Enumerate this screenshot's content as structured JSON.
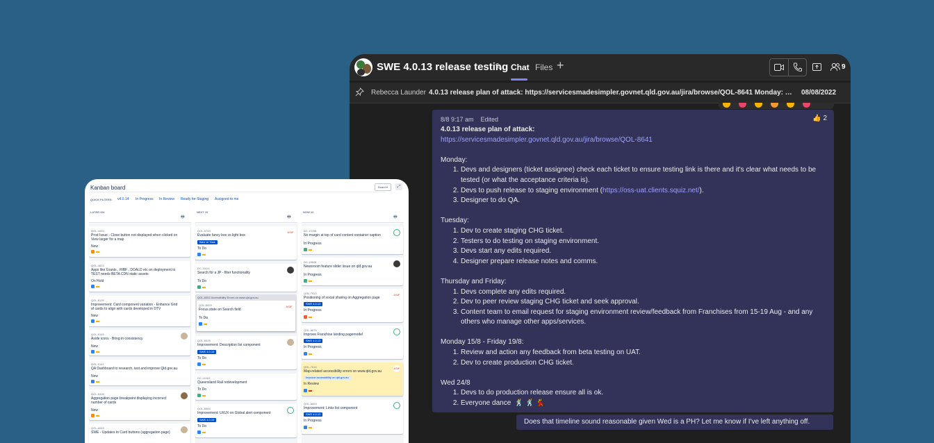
{
  "teams": {
    "title": "SWE 4.0.13 release testing",
    "tabs": {
      "chat": "Chat",
      "files": "Files"
    },
    "participants_count": "9",
    "pinned": {
      "author": "Rebecca Launder",
      "text": "4.0.13 release plan of attack: https://servicesmadesimpler.govnet.qld.gov.au/jira/browse/QOL-8641 Monday: Devs and designers (ticket assignee) check each ticket",
      "date": "08/08/2022"
    },
    "message": {
      "time": "8/8 9:17 am",
      "edited": "Edited",
      "reaction_count": "2",
      "heading": "4.0.13 release plan of attack:",
      "link": "https://servicesmadesimpler.govnet.qld.gov.au/jira/browse/QOL-8641",
      "monday": {
        "label": "Monday:",
        "items": [
          "Devs and designers (ticket assignee) check each ticket to ensure testing link is there and it's clear what needs to be tested (or what the acceptance criteria is).",
          "Devs to push release to staging environment (",
          "Designer to do QA."
        ],
        "staging_link": "https://oss-uat.clients.squiz.net/",
        "staging_suffix": ")."
      },
      "tuesday": {
        "label": "Tuesday:",
        "items": [
          "Dev to create staging CHG ticket.",
          "Testers to do testing on staging environment.",
          "Devs start any edits required.",
          "Designer prepare release notes and comms."
        ]
      },
      "thu_fri": {
        "label": "Thursday and Friday:",
        "items": [
          "Devs complete any edits required.",
          "Dev to peer review staging CHG ticket and seek approval.",
          "Content team to email request for staging environment review/feedback from Franchises from 15-19 Aug - and any others who manage other apps/services."
        ]
      },
      "mon_fri": {
        "label": "Monday 15/8 - Friday 19/8:",
        "items": [
          "Review and action any feedback from beta testing on UAT.",
          "Dev to create production CHG ticket."
        ]
      },
      "wed": {
        "label": "Wed 24/8",
        "items": [
          "Devs to do production release ensure all is ok.",
          "Everyone dance"
        ],
        "dance_emoji": "🕺 🕺 💃"
      }
    },
    "reply": "Does that timeline sound reasonable given Wed is a PH? Let me know if I've left anything off."
  },
  "jira": {
    "title": "Kanban board",
    "board_select": "Board",
    "quick_filters_label": "QUICK FILTERS:",
    "quick_filters": [
      "v4.0.14",
      "In Progress",
      "In Review",
      "Ready for Staging",
      "Assigned to me"
    ],
    "columns": [
      "LATER ON",
      "NEXT 20",
      "NOW 10"
    ],
    "later": [
      {
        "key": "QOL-4493",
        "summary": "Prod Issue - Close button not displayed when clicked on View larger for a map",
        "status": "New"
      },
      {
        "key": "QOL-4823",
        "summary": "Apps like Grants , HIBF , DOALD etc on deployment to TEST needs BETA CDN static assets",
        "status": "On Hold"
      },
      {
        "key": "QOL-8139",
        "summary": "Improvement: Card component variation - Enhance Grid of cards to align with cards developed in DTV",
        "status": "New"
      },
      {
        "key": "QOL-5145",
        "summary": "Aside icons - Bring in consistency",
        "status": "New"
      },
      {
        "key": "QOL-5141",
        "summary": "QA Dashboard to research, test and improve Qld.gov.au",
        "status": "New"
      },
      {
        "key": "QOL-5406",
        "summary": "Aggregation page breakpoint displaying incorrect number of cards",
        "status": "New"
      },
      {
        "key": "QOL-6943",
        "summary": "SWE - Updates to Card buttons (aggregation page)",
        "status": ""
      }
    ],
    "next": [
      {
        "key": "QOL-5749",
        "summary": "Evaluate fancy box vs light box",
        "chip": "BAU UI Task",
        "status": "To Do"
      },
      {
        "key": "DC-11641",
        "summary": "Search for a JP - filter functionality",
        "chip": "",
        "status": "To Do"
      },
      {
        "key": "QOL-6009",
        "summary": "Focus state on Search field",
        "chip": "",
        "status": "To Do"
      },
      {
        "key": "QOL-8028",
        "summary": "Improvement: Description list component",
        "chip": "SWE 4.0.15",
        "status": "To Do"
      },
      {
        "key": "DC-14463",
        "summary": "Queensland Rail redevelopment",
        "chip": "",
        "status": "To Do"
      },
      {
        "key": "QOL-8584",
        "summary": "Improvement: UI/UX on Global alert component",
        "chip": "SWE 4.0.15",
        "status": "To Do"
      }
    ],
    "next_group": "QOL-6002  Accessibility Errors on www.qld.gov.au",
    "now": [
      {
        "key": "DC-13786",
        "summary": "No margin at top of card content container caption",
        "chip": "",
        "status": "In Progress"
      },
      {
        "key": "DC-15608",
        "summary": "Newsroom feature slider issue on qld.gov.au",
        "chip": "",
        "status": "In Progress"
      },
      {
        "key": "QOL-7410",
        "summary": "Positioning of social sharing on Aggregation page",
        "chip": "SWE 4.0.13",
        "status": "In Progress"
      },
      {
        "key": "QOL-8675",
        "summary": "Improve Franchise landing pagemodel",
        "chip": "SWE 4.0.13",
        "status": "In Progress"
      },
      {
        "key": "QOL-7516",
        "summary": "Map-related accessibility errors on www.qld.gov.au",
        "chip": "Improve accessibility on qld.gov.au",
        "status": "In Review"
      },
      {
        "key": "QOL-6653",
        "summary": "Improvement: Links list component",
        "chip": "SWE 4.0.13",
        "status": "In Progress"
      }
    ],
    "asif_label": "ASIF",
    "colors": {
      "chip": "#0052cc",
      "highlight": "#fff0b3"
    }
  }
}
